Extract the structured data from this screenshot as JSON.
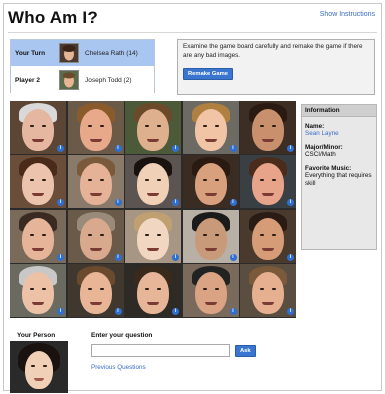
{
  "header": {
    "title": "Who Am I?",
    "show_instructions": "Show Instructions"
  },
  "players": [
    {
      "role": "Your Turn",
      "name": "Chelsea Rath (14)",
      "current": true
    },
    {
      "role": "Player 2",
      "name": "Joseph Todd (2)",
      "current": false
    }
  ],
  "notice": {
    "text": "Examine the game board carefully and remake the game if there are any bad images.",
    "button_label": "Remake Game"
  },
  "board": {
    "rows": 4,
    "cols": 5,
    "info_badge": "i",
    "tiles": [
      {
        "skin": "#e6b7a0",
        "hair": "#d9d9d9",
        "bg": "#5b4636"
      },
      {
        "skin": "#e8a98a",
        "hair": "#8a5a2a",
        "bg": "#6b5a48"
      },
      {
        "skin": "#dfb08e",
        "hair": "#6b4a2a",
        "bg": "#4c5a3a"
      },
      {
        "skin": "#f0c4a4",
        "hair": "#b08040",
        "bg": "#6c6a62"
      },
      {
        "skin": "#c9906e",
        "hair": "#2a1a12",
        "bg": "#3c2e24"
      },
      {
        "skin": "#ecc3ad",
        "hair": "#4a2a18",
        "bg": "#6a4e3a"
      },
      {
        "skin": "#e5b297",
        "hair": "#7a5a3a",
        "bg": "#8a7a6a"
      },
      {
        "skin": "#f0d0b6",
        "hair": "#1a120e",
        "bg": "#5c5450"
      },
      {
        "skin": "#d9a07e",
        "hair": "#2a1a12",
        "bg": "#3a2c22"
      },
      {
        "skin": "#e8a48a",
        "hair": "#4a2c1c",
        "bg": "#3a3f44"
      },
      {
        "skin": "#e6b599",
        "hair": "#3a2a22",
        "bg": "#7a6a5a"
      },
      {
        "skin": "#d8a98c",
        "hair": "#9a8a7a",
        "bg": "#6a5a4a"
      },
      {
        "skin": "#f1d6c2",
        "hair": "#c0a070",
        "bg": "#a89684"
      },
      {
        "skin": "#c99a7a",
        "hair": "#1a1a1a",
        "bg": "#b8b0a4"
      },
      {
        "skin": "#d69c78",
        "hair": "#2a1c14",
        "bg": "#4a3a2e"
      },
      {
        "skin": "#ecc1a6",
        "hair": "#c8c8c8",
        "bg": "#6a6a60"
      },
      {
        "skin": "#e8b596",
        "hair": "#6a4a2e",
        "bg": "#40382e"
      },
      {
        "skin": "#e7b698",
        "hair": "#3a2a1c",
        "bg": "#2e2a26"
      },
      {
        "skin": "#d9a384",
        "hair": "#222222",
        "bg": "#7a6a5c"
      },
      {
        "skin": "#e6b090",
        "hair": "#7a5a3a",
        "bg": "#5a4e40"
      }
    ]
  },
  "info": {
    "header": "Information",
    "name_label": "Name:",
    "name_value": "Sean Layne",
    "major_label": "Major/Minor:",
    "major_value": "CSCI/Math",
    "music_label": "Favorite Music:",
    "music_value": "Everything that requires skill"
  },
  "your_person": {
    "label": "Your Person",
    "skin": "#f0d0b6",
    "hair": "#1a120e",
    "bg": "#2a2a2a"
  },
  "question": {
    "label": "Enter your question",
    "value": "",
    "placeholder": "",
    "ask_label": "Ask",
    "previous_label": "Previous Questions"
  }
}
